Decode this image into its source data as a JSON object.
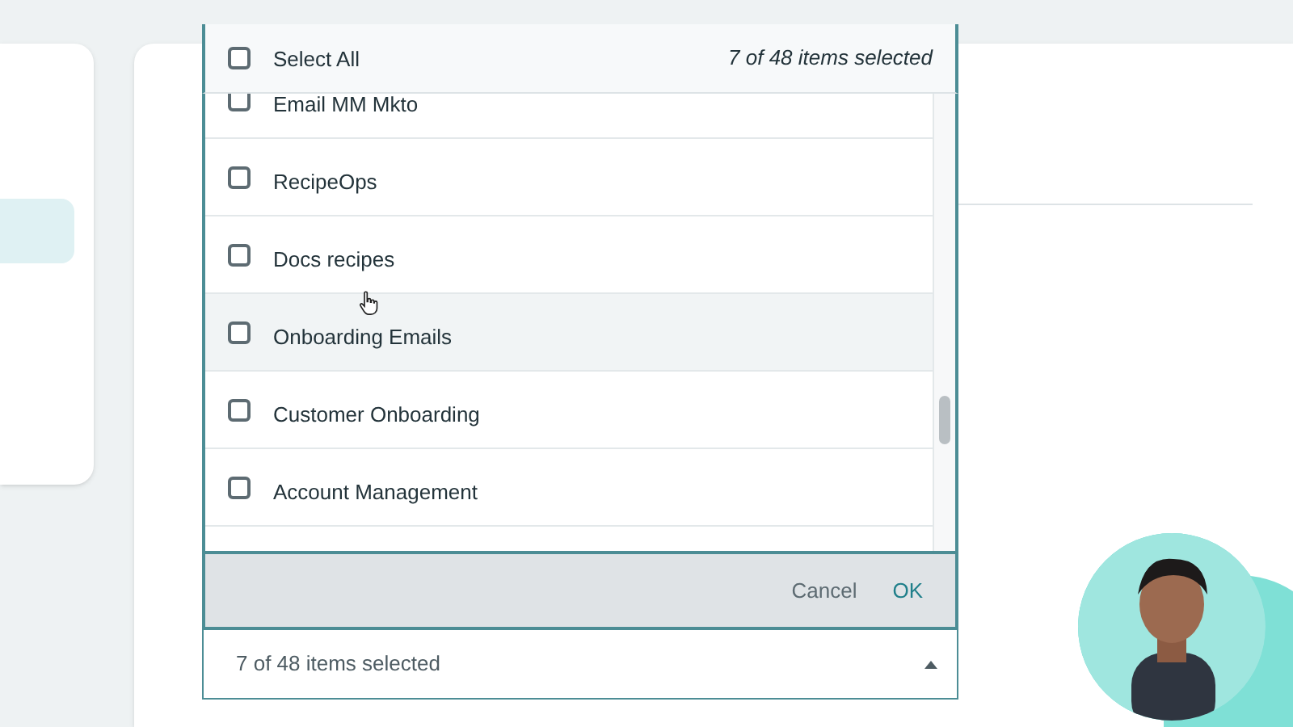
{
  "select_all": {
    "label": "Select All",
    "checked": false,
    "count": "7 of 48 items selected"
  },
  "items": [
    {
      "label": "Email MM Mkto",
      "checked": false,
      "hovered": false
    },
    {
      "label": "RecipeOps",
      "checked": false,
      "hovered": false
    },
    {
      "label": "Docs recipes",
      "checked": false,
      "hovered": false
    },
    {
      "label": "Onboarding Emails",
      "checked": false,
      "hovered": true
    },
    {
      "label": "Customer Onboarding",
      "checked": false,
      "hovered": false
    },
    {
      "label": "Account Management",
      "checked": false,
      "hovered": false
    }
  ],
  "footer": {
    "cancel": "Cancel",
    "ok": "OK"
  },
  "field": {
    "value": "7 of 48 items selected",
    "expanded": true
  }
}
